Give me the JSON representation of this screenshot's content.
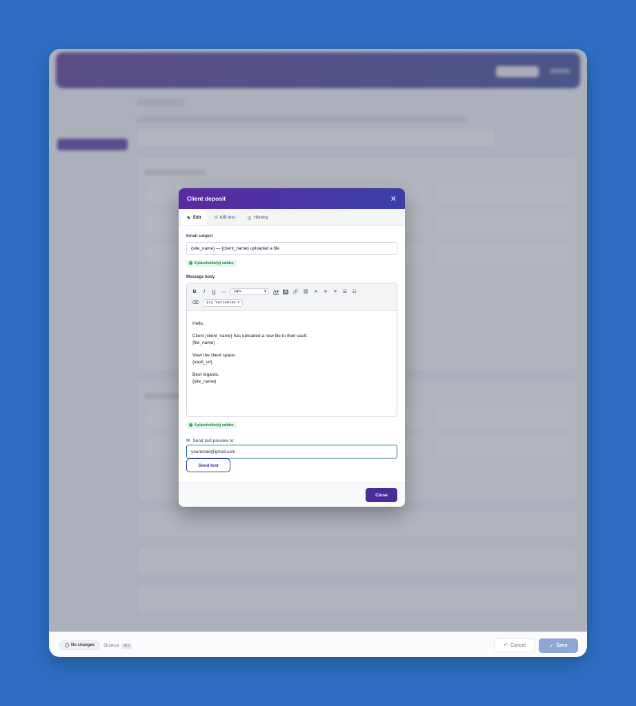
{
  "modal": {
    "title": "Client deposit",
    "close_icon": "close-icon",
    "tabs": [
      {
        "label": "Edit",
        "icon": "pencil-icon"
      },
      {
        "label": "A/B test",
        "icon": "shuffle-icon"
      },
      {
        "label": "History",
        "icon": "clock-icon"
      }
    ],
    "subject_label": "Email subject",
    "subject_value": "{site_name} — {client_name} uploaded a file",
    "subject_badge": "2 placeholder(s) valides",
    "body_label": "Message body",
    "toolbar": {
      "bold": "B",
      "italic": "I",
      "underline": "U",
      "strike": "—",
      "font_size": "14px",
      "variables": "{x} Variables"
    },
    "body_lines": [
      "Hello,",
      "Client {client_name} has uploaded a new file to their vault:",
      "{file_name}",
      "View the client space:",
      "{vault_url}",
      "Best regards,",
      "{site_name}"
    ],
    "body_badge": "4 placeholder(s) valides",
    "send_label": "Send test preview to:",
    "send_value": "youremail@gmail.com",
    "send_button": "Send test",
    "close_button": "Close"
  },
  "footer": {
    "status": "No changes",
    "shortcut_label": "Shortcut",
    "shortcut_key": "⌘S",
    "cancel": "Cancel",
    "save": "Save"
  }
}
